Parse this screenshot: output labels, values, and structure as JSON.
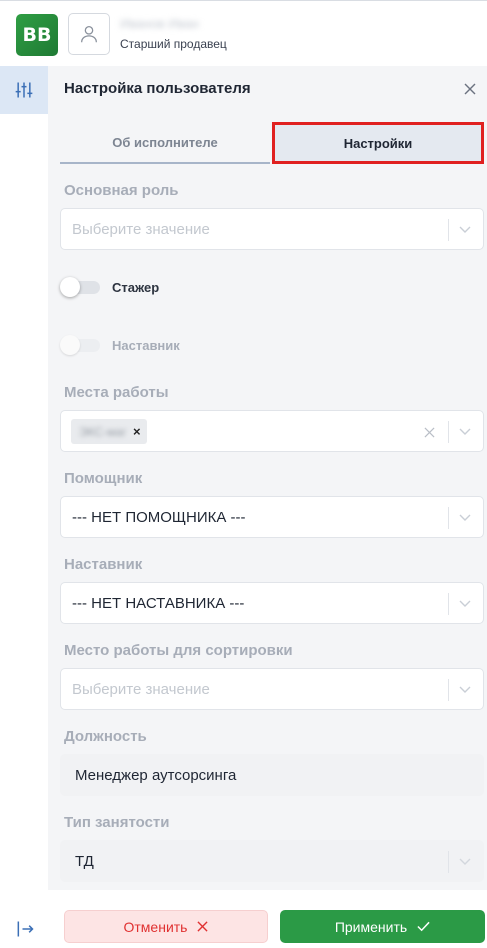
{
  "header": {
    "logo_text": "BB",
    "user_name": "Иванов Иван",
    "user_role": "Старший продавец"
  },
  "panel": {
    "title": "Настройка пользователя",
    "tabs": [
      {
        "label": "Об исполнителе",
        "active": false
      },
      {
        "label": "Настройки",
        "active": true
      }
    ]
  },
  "form": {
    "main_role": {
      "label": "Основная роль",
      "placeholder": "Выберите значение"
    },
    "trainee": {
      "label": "Стажер",
      "on": false
    },
    "mentor_toggle": {
      "label": "Наставник",
      "on": false,
      "disabled": true
    },
    "workplaces": {
      "label": "Места работы",
      "chips": [
        {
          "text": "ЭКС-маг",
          "remove": "×"
        }
      ]
    },
    "assistant": {
      "label": "Помощник",
      "value": "--- НЕТ ПОМОЩНИКА ---"
    },
    "mentor": {
      "label": "Наставник",
      "value": "--- НЕТ НАСТАВНИКА ---"
    },
    "sort_workplace": {
      "label": "Место работы для сортировки",
      "placeholder": "Выберите значение"
    },
    "position": {
      "label": "Должность",
      "value": "Менеджер аутсорсинга"
    },
    "employment_type": {
      "label": "Тип занятости",
      "value": "ТД"
    }
  },
  "footer": {
    "cancel_label": "Отменить",
    "apply_label": "Применить"
  },
  "colors": {
    "brand_green": "#2b9a46",
    "cancel_red": "#e03131",
    "highlight_red": "#e02020",
    "rail_active_bg": "#dce7f5"
  },
  "icons": [
    "user-icon",
    "sliders-icon",
    "logout-icon",
    "close-icon",
    "chevron-down-icon",
    "clear-icon",
    "check-icon"
  ]
}
